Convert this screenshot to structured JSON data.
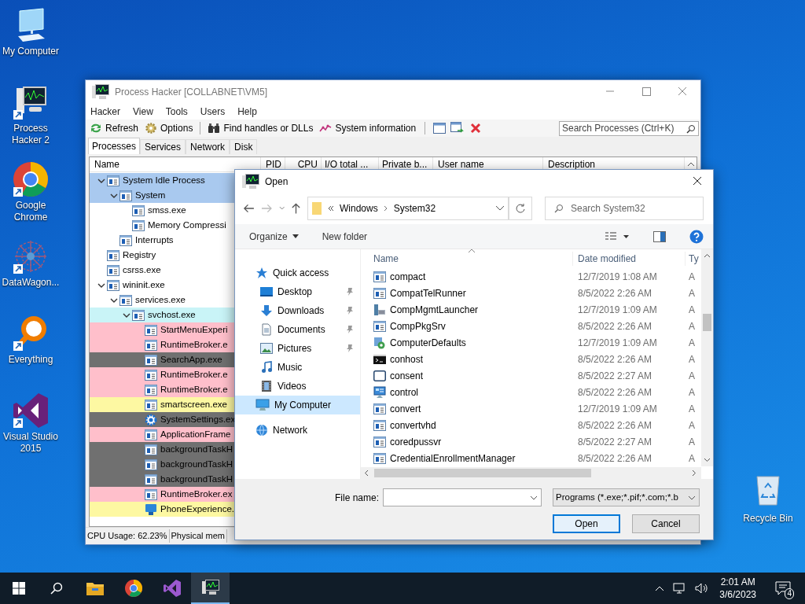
{
  "desktop_icons": [
    {
      "label": "My Computer",
      "kind": "computer"
    },
    {
      "label": "Process Hacker 2",
      "kind": "processhacker"
    },
    {
      "label": "Google Chrome",
      "kind": "chrome"
    },
    {
      "label": "DataWagon...",
      "kind": "datawagon"
    },
    {
      "label": "Everything",
      "kind": "everything"
    },
    {
      "label": "Visual Studio 2015",
      "kind": "vs"
    }
  ],
  "recycle_bin": {
    "label": "Recycle Bin"
  },
  "process_hacker": {
    "title": "Process Hacker [COLLABNET\\VM5]",
    "menu": [
      "Hacker",
      "View",
      "Tools",
      "Users",
      "Help"
    ],
    "toolbar": [
      {
        "label": "Refresh",
        "kind": "refresh"
      },
      {
        "label": "Options",
        "kind": "options"
      },
      {
        "label": "Find handles or DLLs",
        "kind": "find"
      },
      {
        "label": "System information",
        "kind": "sysinfo"
      }
    ],
    "search": {
      "placeholder": "Search Processes (Ctrl+K)"
    },
    "tabs": [
      {
        "label": "Processes",
        "selected": true
      },
      {
        "label": "Services",
        "selected": false
      },
      {
        "label": "Network",
        "selected": false
      },
      {
        "label": "Disk",
        "selected": false
      }
    ],
    "columns": [
      "Name",
      "PID",
      "CPU",
      "I/O total ...",
      "Private b...",
      "User name",
      "Description"
    ],
    "processes": [
      {
        "name": "System Idle Process",
        "color": "#a9c9ef",
        "expanded": true,
        "children": [
          {
            "name": "System",
            "color": "#a9c9ef",
            "expanded": true,
            "children": [
              {
                "name": "smss.exe"
              },
              {
                "name": "Memory Compressi"
              }
            ]
          },
          {
            "name": "Interrupts"
          }
        ]
      },
      {
        "name": "Registry"
      },
      {
        "name": "csrss.exe"
      },
      {
        "name": "wininit.exe",
        "expanded": true,
        "children": [
          {
            "name": "services.exe",
            "expanded": true,
            "children": [
              {
                "name": "svchost.exe",
                "color": "#c9f4f7",
                "expanded": true,
                "children": [
                  {
                    "name": "StartMenuExperi",
                    "color": "#ffbfcb"
                  },
                  {
                    "name": "RuntimeBroker.e",
                    "color": "#ffbfcb"
                  },
                  {
                    "name": "SearchApp.exe",
                    "color": "#707070"
                  },
                  {
                    "name": "RuntimeBroker.e",
                    "color": "#ffbfcb"
                  },
                  {
                    "name": "RuntimeBroker.e",
                    "color": "#ffbfcb"
                  },
                  {
                    "name": "smartscreen.exe",
                    "color": "#fdf8a2"
                  },
                  {
                    "name": "SystemSettings.ex",
                    "color": "#707070",
                    "kind": "settings"
                  },
                  {
                    "name": "ApplicationFrame",
                    "color": "#ffbfcb"
                  },
                  {
                    "name": "backgroundTaskH",
                    "color": "#707070"
                  },
                  {
                    "name": "backgroundTaskH",
                    "color": "#707070"
                  },
                  {
                    "name": "backgroundTaskH",
                    "color": "#707070"
                  },
                  {
                    "name": "RuntimeBroker.ex",
                    "color": "#ffbfcb"
                  },
                  {
                    "name": "PhoneExperience.",
                    "color": "#fdf8a2",
                    "kind": "phone"
                  }
                ]
              }
            ]
          }
        ]
      }
    ],
    "status_bar": [
      "CPU Usage: 62.23%",
      "Physical mem"
    ]
  },
  "open_dialog": {
    "title": "Open",
    "address": [
      "Windows",
      "System32"
    ],
    "search": {
      "placeholder": "Search System32"
    },
    "toolbar": [
      {
        "label": "Organize",
        "kind": "menu"
      },
      {
        "label": "New folder",
        "kind": "button"
      }
    ],
    "nav": [
      {
        "label": "Quick access",
        "kind": "star",
        "selected": false,
        "children": [
          {
            "label": "Desktop",
            "kind": "desktop",
            "pinned": true,
            "selected": false
          },
          {
            "label": "Downloads",
            "kind": "download",
            "pinned": true,
            "selected": false
          },
          {
            "label": "Documents",
            "kind": "documents",
            "pinned": true,
            "selected": false
          },
          {
            "label": "Pictures",
            "kind": "pictures",
            "pinned": true,
            "selected": false
          },
          {
            "label": "Music",
            "kind": "music",
            "pinned": false,
            "selected": false
          },
          {
            "label": "Videos",
            "kind": "videos",
            "pinned": false,
            "selected": false
          }
        ]
      },
      {
        "label": "My Computer",
        "kind": "computer",
        "selected": true
      },
      {
        "label": "Network",
        "kind": "network",
        "selected": false
      }
    ],
    "columns": [
      "Name",
      "Date modified",
      "Ty"
    ],
    "files": [
      {
        "name": "compact",
        "date": "12/7/2019 1:08 AM",
        "type": "A",
        "kind": "app"
      },
      {
        "name": "CompatTelRunner",
        "date": "8/5/2022 2:26 AM",
        "type": "A",
        "kind": "app"
      },
      {
        "name": "CompMgmtLauncher",
        "date": "12/7/2019 1:09 AM",
        "type": "A",
        "kind": "mgmt"
      },
      {
        "name": "CompPkgSrv",
        "date": "8/5/2022 2:26 AM",
        "type": "A",
        "kind": "app"
      },
      {
        "name": "ComputerDefaults",
        "date": "12/7/2019 1:09 AM",
        "type": "A",
        "kind": "defaults"
      },
      {
        "name": "conhost",
        "date": "8/5/2022 2:26 AM",
        "type": "A",
        "kind": "console"
      },
      {
        "name": "consent",
        "date": "8/5/2022 2:27 AM",
        "type": "A",
        "kind": "window"
      },
      {
        "name": "control",
        "date": "8/5/2022 2:26 AM",
        "type": "A",
        "kind": "control"
      },
      {
        "name": "convert",
        "date": "12/7/2019 1:09 AM",
        "type": "A",
        "kind": "app"
      },
      {
        "name": "convertvhd",
        "date": "8/5/2022 2:26 AM",
        "type": "A",
        "kind": "app"
      },
      {
        "name": "coredpussvr",
        "date": "8/5/2022 2:27 AM",
        "type": "A",
        "kind": "app"
      },
      {
        "name": "CredentialEnrollmentManager",
        "date": "8/5/2022 2:26 AM",
        "type": "A",
        "kind": "app"
      }
    ],
    "file_name_label": "File name:",
    "filter": "Programs (*.exe;*.pif;*.com;*.b",
    "buttons": [
      {
        "label": "Open",
        "default": true
      },
      {
        "label": "Cancel",
        "default": false
      }
    ]
  },
  "taskbar": {
    "apps": [
      {
        "kind": "explorer",
        "active": false
      },
      {
        "kind": "chrome",
        "active": false
      },
      {
        "kind": "vs",
        "active": false
      },
      {
        "kind": "processhacker",
        "active": true
      }
    ],
    "time": "2:01 AM",
    "date": "3/6/2023",
    "notifications": "4"
  }
}
